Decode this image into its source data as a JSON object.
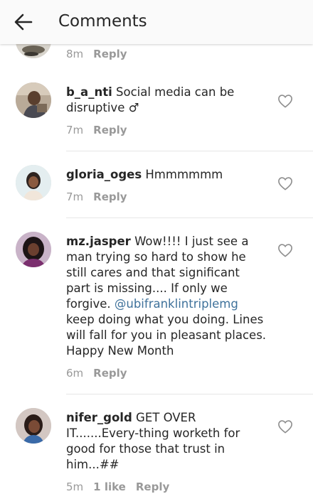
{
  "header": {
    "title": "Comments",
    "back_icon": "arrow-left-icon"
  },
  "partial_comment": {
    "time": "8m",
    "reply_label": "Reply"
  },
  "comments": [
    {
      "username": "b_a_nti",
      "text": "Social media can be disruptive ♂",
      "time": "7m",
      "reply_label": "Reply"
    },
    {
      "username": "gloria_oges",
      "text": "Hmmmmmm",
      "time": "7m",
      "reply_label": "Reply"
    },
    {
      "username": "mz.jasper",
      "text_before": "Wow!!!! I just see a man trying so hard to show he still cares and that significant part is missing.... If only we forgive.",
      "mention": "@ubifranklintriplemg",
      "text_after": "keep doing what you doing. Lines will fall for you in pleasant places. Happy New Month",
      "time": "6m",
      "reply_label": "Reply"
    },
    {
      "username": "nifer_gold",
      "text": "GET OVER IT.......Every-thing worketh for good for those that trust in him...##",
      "time": "5m",
      "likes": "1 like",
      "reply_label": "Reply"
    }
  ],
  "colors": {
    "text": "#262626",
    "meta": "#999999",
    "mention": "#3f729b",
    "divider": "#e6e6e6"
  }
}
